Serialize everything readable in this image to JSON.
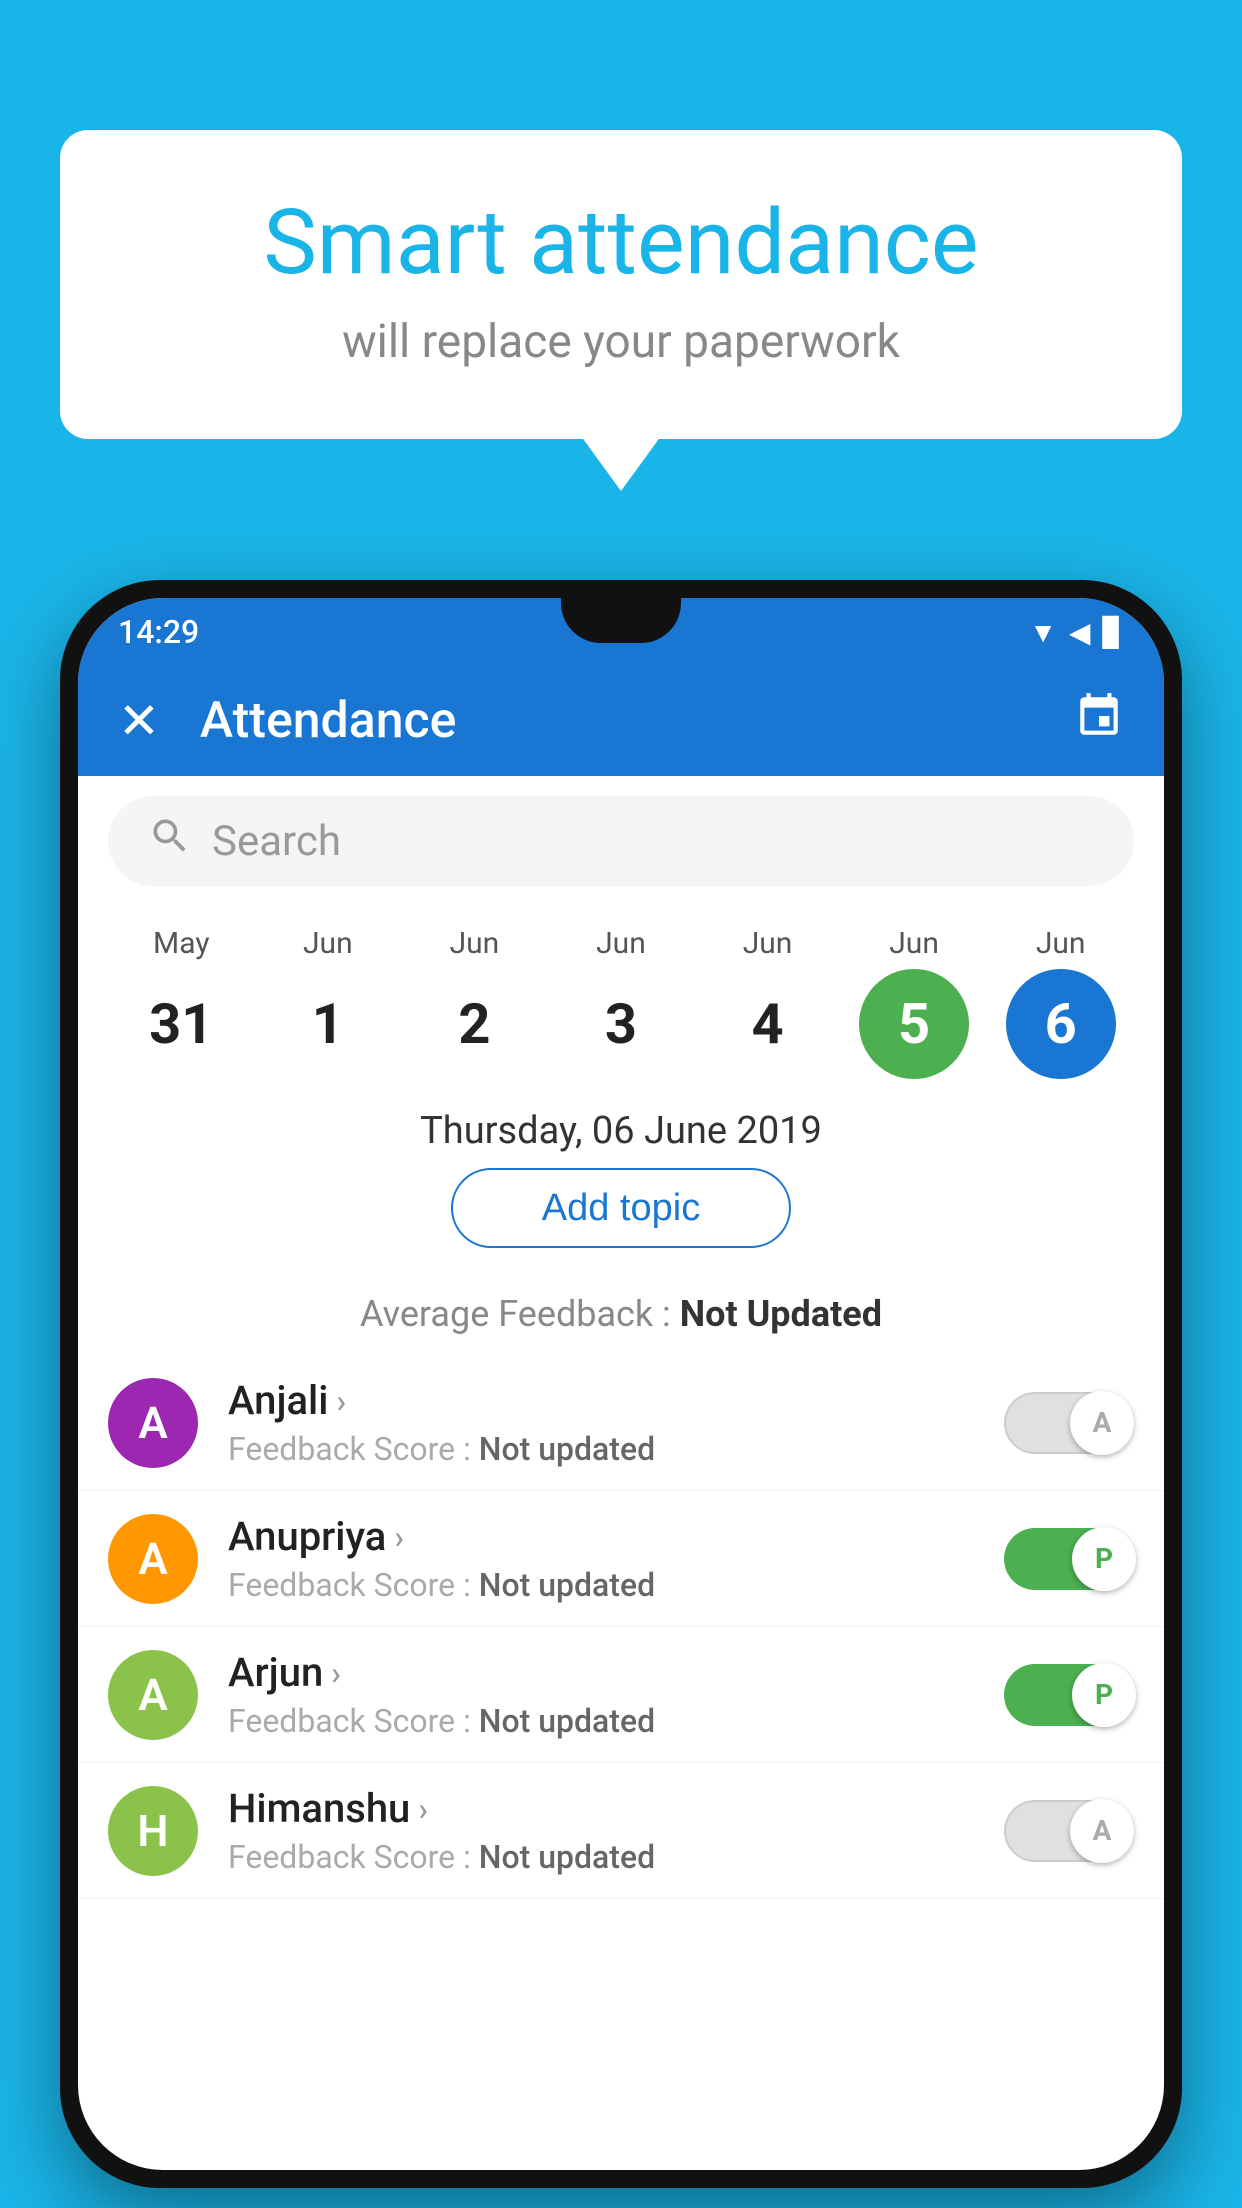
{
  "background_color": "#1ab5e8",
  "bubble": {
    "title": "Smart attendance",
    "subtitle": "will replace your paperwork"
  },
  "phone": {
    "status_bar": {
      "time": "14:29"
    },
    "app_bar": {
      "title": "Attendance",
      "close_label": "✕",
      "calendar_icon": "📅"
    },
    "search": {
      "placeholder": "Search"
    },
    "calendar": {
      "days": [
        {
          "month": "May",
          "date": "31",
          "style": "normal"
        },
        {
          "month": "Jun",
          "date": "1",
          "style": "normal"
        },
        {
          "month": "Jun",
          "date": "2",
          "style": "normal"
        },
        {
          "month": "Jun",
          "date": "3",
          "style": "normal"
        },
        {
          "month": "Jun",
          "date": "4",
          "style": "normal"
        },
        {
          "month": "Jun",
          "date": "5",
          "style": "today"
        },
        {
          "month": "Jun",
          "date": "6",
          "style": "selected"
        }
      ]
    },
    "selected_date": "Thursday, 06 June 2019",
    "add_topic_label": "Add topic",
    "avg_feedback_label": "Average Feedback :",
    "avg_feedback_value": "Not Updated",
    "students": [
      {
        "name": "Anjali",
        "avatar_letter": "A",
        "avatar_color": "#9c27b0",
        "feedback_label": "Feedback Score :",
        "feedback_value": "Not updated",
        "toggle": "off",
        "toggle_label": "A"
      },
      {
        "name": "Anupriya",
        "avatar_letter": "A",
        "avatar_color": "#ff9800",
        "feedback_label": "Feedback Score :",
        "feedback_value": "Not updated",
        "toggle": "on",
        "toggle_label": "P"
      },
      {
        "name": "Arjun",
        "avatar_letter": "A",
        "avatar_color": "#8bc34a",
        "feedback_label": "Feedback Score :",
        "feedback_value": "Not updated",
        "toggle": "on",
        "toggle_label": "P"
      },
      {
        "name": "Himanshu",
        "avatar_letter": "H",
        "avatar_color": "#8bc34a",
        "feedback_label": "Feedback Score :",
        "feedback_value": "Not updated",
        "toggle": "off",
        "toggle_label": "A"
      }
    ]
  }
}
